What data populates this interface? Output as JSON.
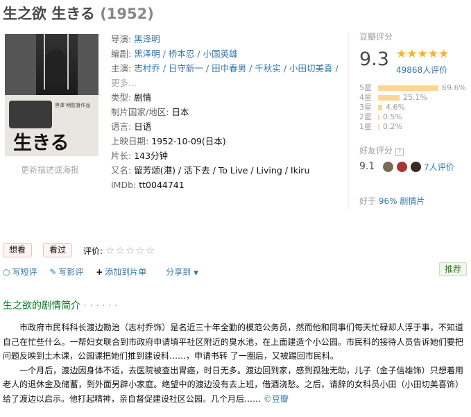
{
  "title": {
    "name": "生之欲 生きる",
    "year": "(1952)"
  },
  "poster": {
    "caption": "更新描述或海报",
    "text": "生きる",
    "small": "黒澤 明監督作品"
  },
  "info": {
    "director": {
      "label": "导演:",
      "names": [
        "黑泽明"
      ]
    },
    "writer": {
      "label": "编剧:",
      "names": [
        "黑泽明",
        "桥本忍",
        "小国英雄"
      ]
    },
    "cast": {
      "label": "主演:",
      "names": [
        "志村乔",
        "日守新一",
        "田中春男",
        "千秋实",
        "小田切美喜"
      ],
      "more": "更多..."
    },
    "genre": {
      "label": "类型:",
      "value": "剧情"
    },
    "country": {
      "label": "制片国家/地区:",
      "value": "日本"
    },
    "language": {
      "label": "语言:",
      "value": "日语"
    },
    "release": {
      "label": "上映日期:",
      "value": "1952-10-09(日本)"
    },
    "runtime": {
      "label": "片长:",
      "value": "143分钟"
    },
    "aka": {
      "label": "又名:",
      "value": "留芳颂(港) / 活下去 / To Live / Living / Ikiru"
    },
    "imdb": {
      "label": "IMDb:",
      "value": "tt0044741"
    }
  },
  "rating": {
    "title": "豆瓣评分",
    "score": "9.3",
    "stars": "★★★★★",
    "votes": "49868人评价",
    "bars": [
      {
        "label": "5星",
        "pct": "69.6%",
        "value": 0.696
      },
      {
        "label": "4星",
        "pct": "25.1%",
        "value": 0.251
      },
      {
        "label": "3星",
        "pct": "4.6%",
        "value": 0.046
      },
      {
        "label": "2星",
        "pct": "0.5%",
        "value": 0.005
      },
      {
        "label": "1星",
        "pct": "0.2%",
        "value": 0.002
      }
    ],
    "friend_title": "好友评分",
    "friend_help": "?",
    "friend_score": "9.1",
    "friend_count": "7人评价",
    "better_prefix": "好于 ",
    "better_value": "96% 剧情片"
  },
  "colors": {
    "accent": "#37a",
    "star": "#ffac2d",
    "bar": "#ffd596",
    "green": "#072"
  },
  "actions": {
    "want": "想看",
    "seen": "看过",
    "my_rating_label": "评价:",
    "empty_stars": "☆☆☆☆☆",
    "write_review_short": "写短评",
    "write_review": "写影评",
    "add_list": "添加到片单",
    "share": "分享到",
    "recommend": "推荐"
  },
  "synopsis": {
    "title": "生之欲的剧情简介",
    "dots": " · · · · · ·",
    "p1": "市政府市民科科长渡边勘治（志村乔饰）是名近三十年全勤的模范公务员，然而他和同事们每天忙碌却人浮于事，不知道自己在忙些什么。一帮妇女联合到市政府申请填平社区附近的臭水池，在上面建造个小公园。市民科的接待人员告诉她们要把问题反映到土木课，公园课把她们推到建设科……，申请书转 了一圈后，又被踢回市民科。",
    "p2": "一个月后，渡边因身体不适，去医院被查出胃癌，时日无多。渡边回到家，感到孤独无助，儿子（金子信雄饰）只想着用老人的退休金及储蓄，到外面另辟小家庭。绝望中的渡边没有去上班，借酒浇愁。之后，请辞的女科员小田（小田切美喜饰）给了渡边以启示。他打起精神，亲自督促建设社区公园。几个月后……",
    "source": "©豆瓣"
  }
}
